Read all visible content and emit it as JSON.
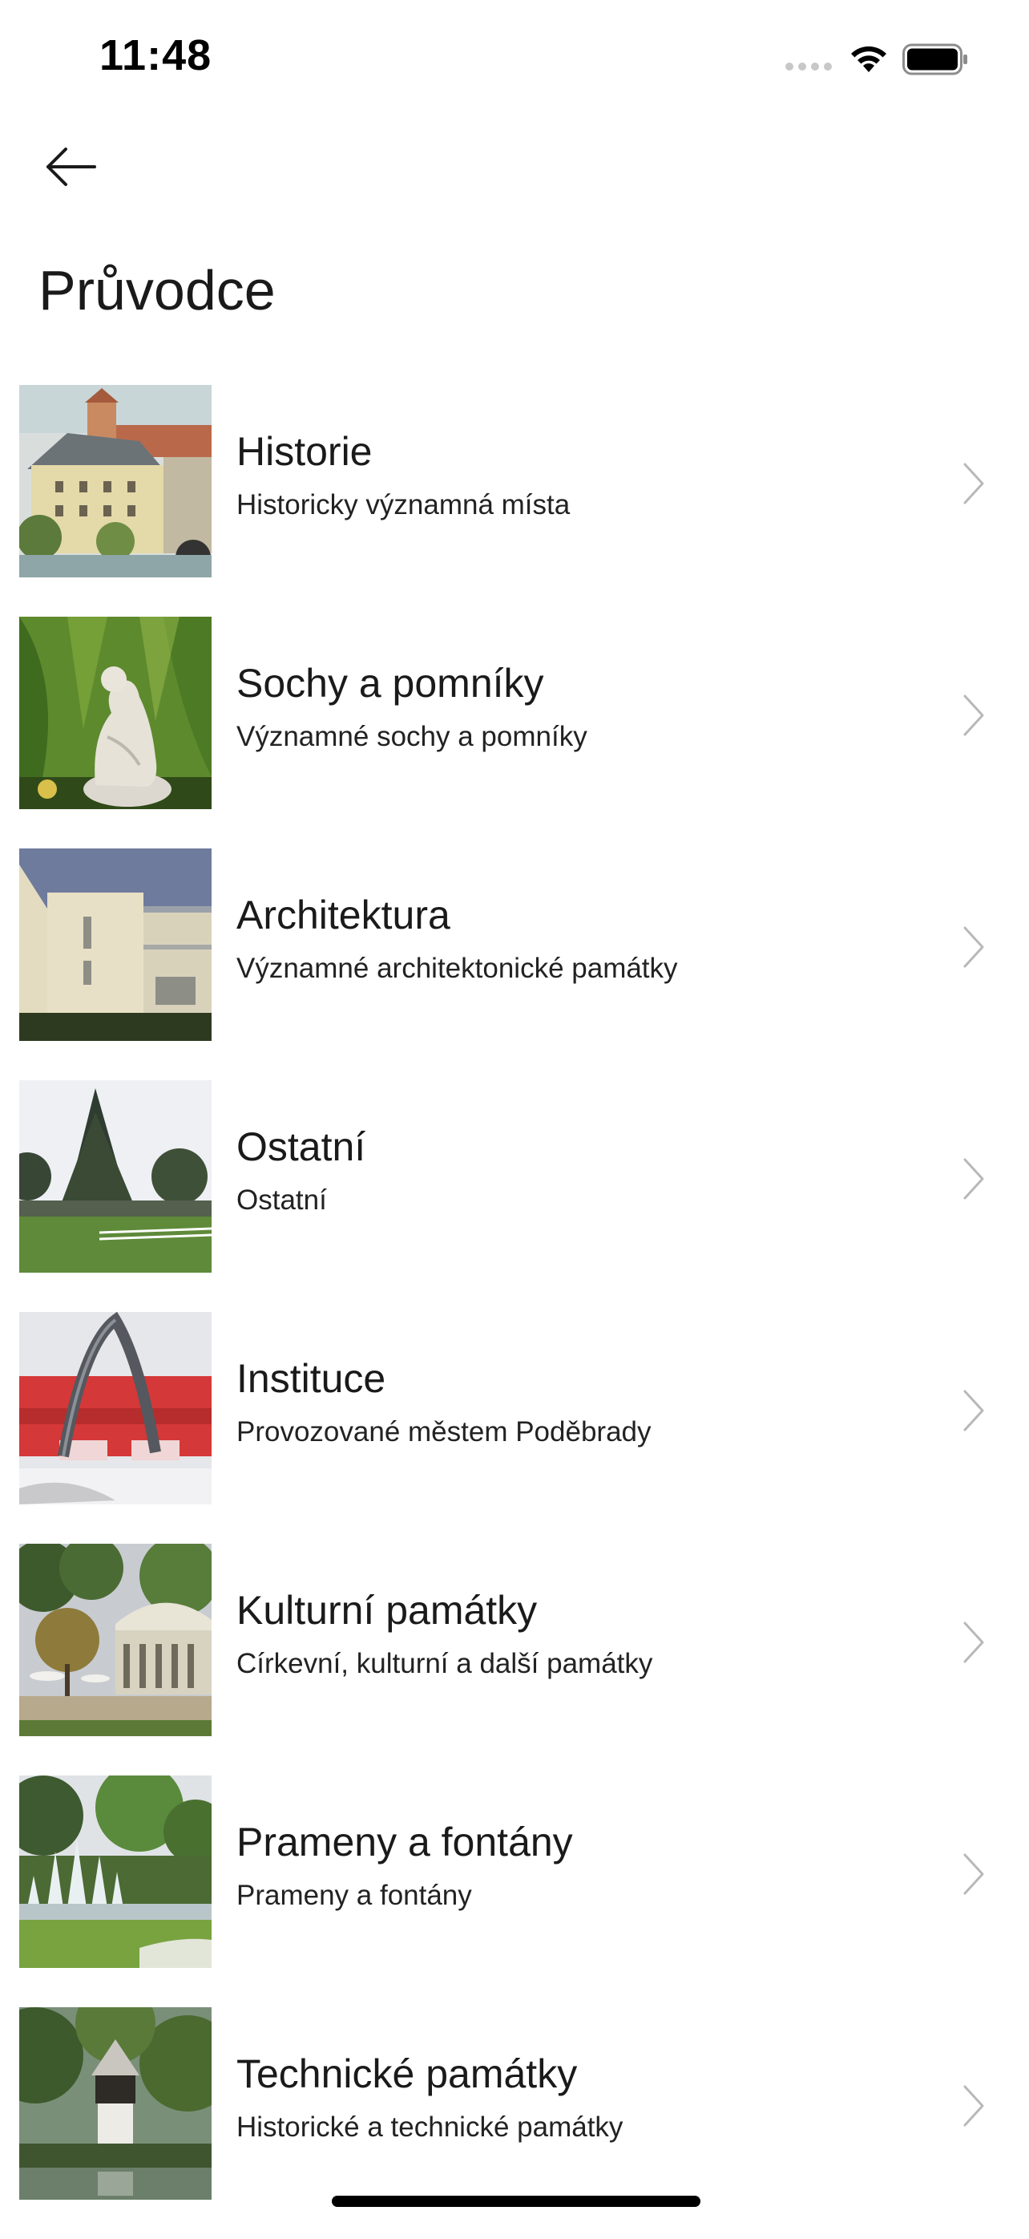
{
  "status_bar": {
    "time": "11:48",
    "wifi_icon": "wifi-icon",
    "battery_icon": "battery-icon"
  },
  "nav": {
    "back_icon": "arrow-left-icon"
  },
  "title": "Průvodce",
  "items": [
    {
      "title": "Historie",
      "subtitle": "Historicky významná místa",
      "image": "castle-photo"
    },
    {
      "title": "Sochy a pomníky",
      "subtitle": "Významné sochy a pomníky",
      "image": "statue-photo"
    },
    {
      "title": "Architektura",
      "subtitle": "Významné architektonické památky",
      "image": "building-photo"
    },
    {
      "title": "Ostatní",
      "subtitle": "Ostatní",
      "image": "park-photo"
    },
    {
      "title": "Instituce",
      "subtitle": "Provozované městem Poděbrady",
      "image": "institution-photo"
    },
    {
      "title": "Kulturní památky",
      "subtitle": "Církevní, kulturní a další památky",
      "image": "colonnade-photo"
    },
    {
      "title": "Prameny a fontány",
      "subtitle": "Prameny a fontány",
      "image": "fountain-photo"
    },
    {
      "title": "Technické památky",
      "subtitle": "Historické a technické památky",
      "image": "tower-photo"
    }
  ],
  "colors": {
    "text": "#1a1a1a",
    "chevron": "#b8b8b8",
    "background": "#ffffff"
  }
}
